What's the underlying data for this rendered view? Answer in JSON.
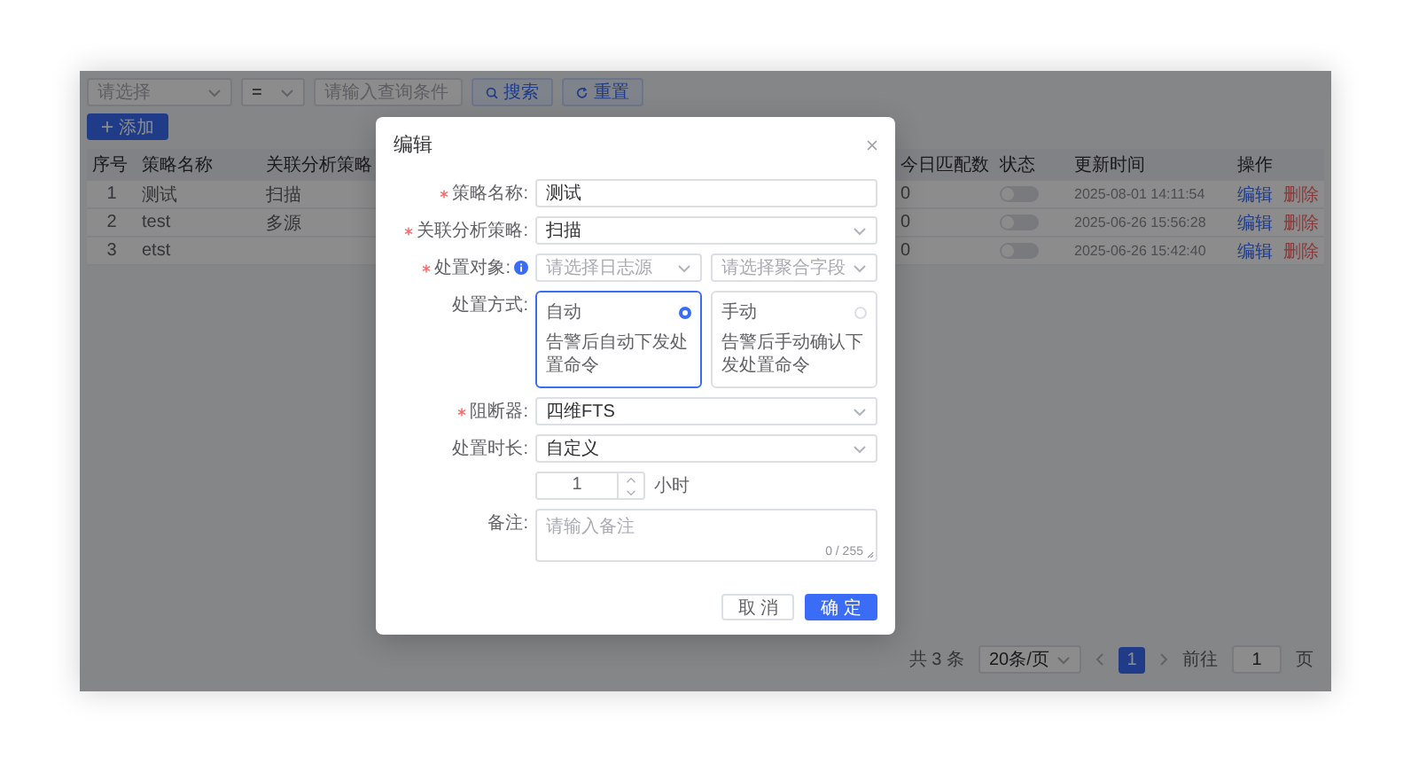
{
  "filters": {
    "field": {
      "placeholder": "请选择"
    },
    "operator": {
      "value": "="
    },
    "query": {
      "placeholder": "请输入查询条件"
    },
    "buttons": [
      {
        "label": "搜索",
        "kind": "search"
      },
      {
        "label": "重置",
        "kind": "reset"
      }
    ]
  },
  "add_button": "添加",
  "table": {
    "columns": [
      "序号",
      "策略名称",
      "关联分析策略",
      "今日匹配数",
      "状态",
      "更新时间",
      "操作"
    ],
    "rows": [
      {
        "index": "1",
        "name": "测试",
        "analysis": "扫描",
        "matches": "0",
        "enabled": false,
        "updated": "2025-08-01 14:11:54",
        "actions": [
          {
            "label": "编辑",
            "kind": "edit"
          },
          {
            "label": "删除",
            "kind": "delete"
          }
        ]
      },
      {
        "index": "2",
        "name": "test",
        "analysis": "多源",
        "matches": "0",
        "enabled": false,
        "updated": "2025-06-26 15:56:28",
        "actions": [
          {
            "label": "编辑",
            "kind": "edit"
          },
          {
            "label": "删除",
            "kind": "delete"
          }
        ]
      },
      {
        "index": "3",
        "name": "etst",
        "matches": "0",
        "enabled": false,
        "updated": "2025-06-26 15:42:40",
        "actions": [
          {
            "label": "编辑",
            "kind": "edit"
          },
          {
            "label": "删除",
            "kind": "delete"
          }
        ]
      }
    ]
  },
  "pagination": {
    "total": "共 3 条",
    "page_size": "20条/页",
    "pages": [
      {
        "label": "1",
        "selected": true
      }
    ],
    "goto_label": "前往",
    "goto_value": "1",
    "goto_unit": "页"
  },
  "dialog": {
    "title": "编辑",
    "fields": [
      {
        "kind": "input",
        "label": "策略名称:",
        "required": true,
        "value": "测试"
      },
      {
        "kind": "select",
        "label": "关联分析策略:",
        "required": true,
        "value": "扫描"
      },
      {
        "kind": "select-pair",
        "label": "处置对象:",
        "required": true,
        "selects": [
          {
            "placeholder": "请选择日志源"
          },
          {
            "placeholder": "请选择聚合字段"
          }
        ]
      },
      {
        "kind": "choice",
        "label": "处置方式:",
        "required": false,
        "options": [
          {
            "title": "自动",
            "description": "告警后自动下发处置命令",
            "selected": true
          },
          {
            "title": "手动",
            "description": "告警后手动确认下发处置命令",
            "selected": false
          }
        ]
      },
      {
        "kind": "select",
        "label": "阻断器:",
        "required": true,
        "value": "四维FTS"
      },
      {
        "kind": "select",
        "label": "处置时长:",
        "required": false,
        "value": "自定义"
      },
      {
        "kind": "number",
        "value": "1",
        "unit": "小时"
      },
      {
        "kind": "textarea",
        "label": "备注:",
        "required": false,
        "placeholder": "请输入备注",
        "counter": "0 / 255"
      }
    ],
    "buttons": [
      {
        "label": "取 消",
        "kind": "default"
      },
      {
        "label": "确 定",
        "kind": "primary"
      }
    ]
  }
}
